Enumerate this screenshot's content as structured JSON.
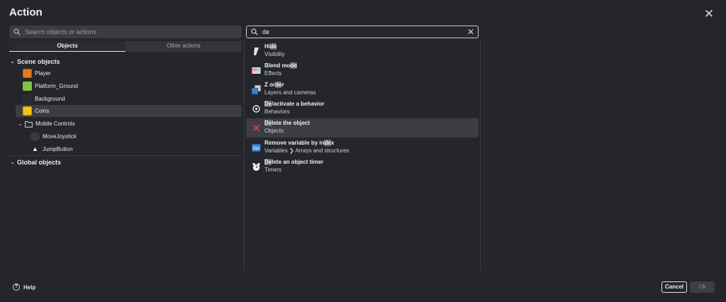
{
  "dialog": {
    "title": "Action"
  },
  "left": {
    "search_placeholder": "Search objects or actions",
    "tabs": [
      {
        "label": "Objects",
        "active": true
      },
      {
        "label": "Other actions",
        "active": false
      }
    ],
    "scene_header": "Scene objects",
    "objects": [
      {
        "label": "Player",
        "icon": "player-sprite-icon"
      },
      {
        "label": "Platform_Ground",
        "icon": "platform-ground-icon"
      },
      {
        "label": "Background",
        "icon": "background-icon"
      },
      {
        "label": "Coins",
        "icon": "coin-sprite-icon",
        "selected": true
      }
    ],
    "folder": {
      "label": "Mobile Controls",
      "children": [
        {
          "label": "MoveJoystick"
        },
        {
          "label": "JumpButton"
        }
      ]
    },
    "global_header": "Global objects"
  },
  "right": {
    "search_value": "de",
    "results": [
      {
        "title_pre": "Hi",
        "title_hl": "de",
        "title_post": "",
        "subtitle": "Visibility",
        "icon": "hide-icon"
      },
      {
        "title_pre": "Blend mo",
        "title_hl": "de",
        "title_post": "",
        "subtitle": "Effects",
        "icon": "blend-mode-icon"
      },
      {
        "title_pre": "Z or",
        "title_hl": "de",
        "title_post": "r",
        "subtitle": "Layers and cameras",
        "icon": "z-order-icon"
      },
      {
        "title_pre": "",
        "title_hl": "De",
        "title_post": "/activate a behavior",
        "subtitle": "Behaviors",
        "icon": "behavior-icon"
      },
      {
        "title_pre": "",
        "title_hl": "De",
        "title_post": "lete the object",
        "subtitle": "Objects",
        "icon": "delete-icon",
        "selected": true
      },
      {
        "title_pre": "Remove variable by in",
        "title_hl": "de",
        "title_post": "x",
        "subtitle": "Variables ❯ Arrays and structures",
        "icon": "variable-icon"
      },
      {
        "title_pre": "",
        "title_hl": "De",
        "title_post": "lete an object timer",
        "subtitle": "Timers",
        "icon": "timer-icon"
      }
    ]
  },
  "footer": {
    "help_label": "Help",
    "cancel_label": "Cancel",
    "ok_label": "Ok"
  },
  "colors": {
    "background": "#25262b",
    "selected_row": "#3c3d44",
    "highlight": "#6b6c73"
  }
}
